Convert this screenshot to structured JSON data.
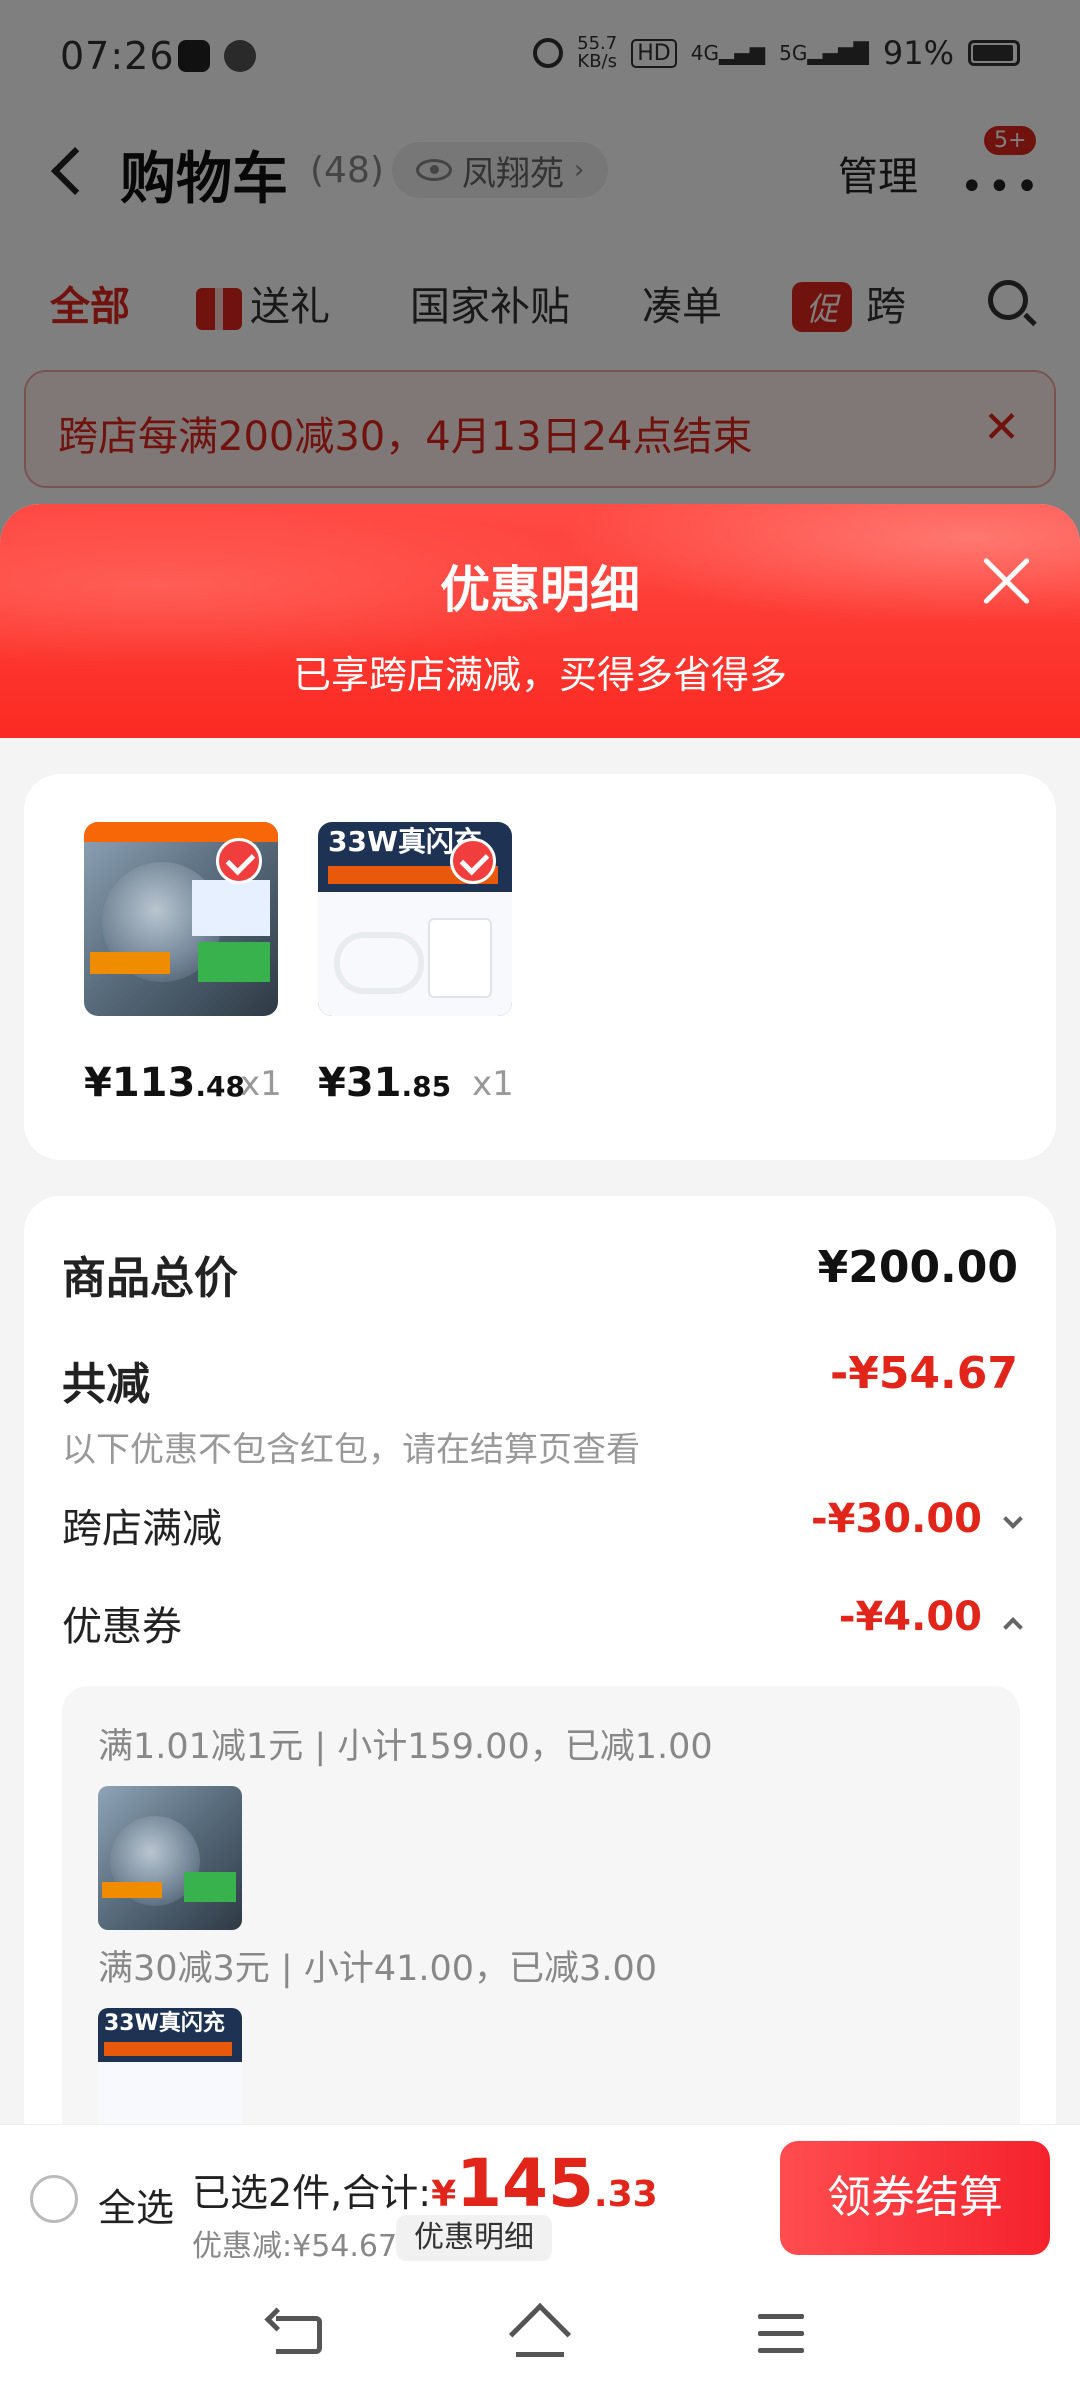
{
  "status_bar": {
    "time": "07:26",
    "net_speed_value": "55.7",
    "net_speed_unit": "KB/s",
    "hd_badge": "HD",
    "signal_1": "4G",
    "signal_2": "5G",
    "battery": "91%"
  },
  "header": {
    "title": "购物车",
    "count": "(48)",
    "location": "凤翔苑",
    "manage_label": "管理",
    "more_badge": "5+"
  },
  "tabs": [
    {
      "label": "全部",
      "active": true
    },
    {
      "label": "送礼"
    },
    {
      "label": "国家补贴"
    },
    {
      "label": "凑单"
    },
    {
      "label": "跨",
      "tag": "促"
    }
  ],
  "promo_banner": {
    "text": "跨店每满200减30，4月13日24点结束"
  },
  "sheet": {
    "title": "优惠明细",
    "subtitle": "已享跨店满减，买得多省得多",
    "items": [
      {
        "price_int": "¥113",
        "price_dec": ".48",
        "qty": "x1"
      },
      {
        "price_int": "¥31",
        "price_dec": ".85",
        "qty": "x1",
        "image_text": "33W真闪充"
      }
    ],
    "total_label": "商品总价",
    "total_value": "¥200.00",
    "reduce_label": "共减",
    "reduce_value": "-¥54.67",
    "reduce_note": "以下优惠不包含红包，请在结算页查看",
    "cross_store_label": "跨店满减",
    "cross_store_value": "-¥30.00",
    "coupon_label": "优惠券",
    "coupon_value": "-¥4.00",
    "coupon_lines": [
      "满1.01减1元 | 小计159.00，已减1.00",
      "满30减3元 | 小计41.00，已减3.00"
    ]
  },
  "checkout": {
    "select_all": "全选",
    "selected_text": "已选2件,合计:",
    "currency": "¥",
    "total_int": "145",
    "total_dec": ".33",
    "discount_text": "优惠减:¥54.67",
    "detail_chip": "优惠明细",
    "button_label": "领券结算"
  },
  "colors": {
    "brand_red": "#e1251b",
    "sheet_header_red": "#fb2a22"
  }
}
